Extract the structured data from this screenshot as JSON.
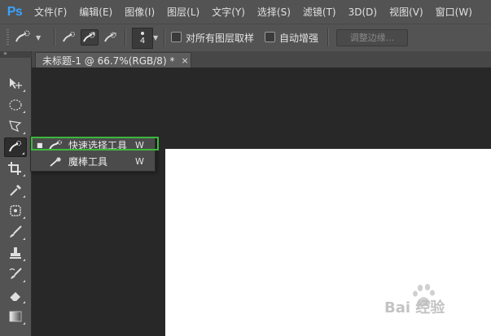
{
  "app": {
    "logo": "Ps"
  },
  "menubar": {
    "items": [
      "文件(F)",
      "编辑(E)",
      "图像(I)",
      "图层(L)",
      "文字(Y)",
      "选择(S)",
      "滤镜(T)",
      "3D(D)",
      "视图(V)",
      "窗口(W)"
    ]
  },
  "options": {
    "tool_icon": "quick-selection-icon",
    "modes": [
      "new-selection-icon",
      "add-to-selection-icon",
      "subtract-from-selection-icon"
    ],
    "brush_size": "4",
    "sample_all_layers_label": "对所有图层取样",
    "sample_all_layers_checked": false,
    "auto_enhance_label": "自动增强",
    "auto_enhance_checked": false,
    "refine_edge_label": "调整边缘..."
  },
  "toolbar": {
    "collapse_glyph": "»",
    "tools": [
      "move-tool-icon",
      "marquee-tool-icon",
      "lasso-tool-icon",
      "quick-selection-tool-icon",
      "crop-tool-icon",
      "eyedropper-tool-icon",
      "spot-healing-tool-icon",
      "brush-tool-icon",
      "clone-stamp-tool-icon",
      "history-brush-tool-icon",
      "eraser-tool-icon",
      "gradient-tool-icon"
    ],
    "active_tool": "quick-selection-tool-icon"
  },
  "document": {
    "tab_title": "未标题-1 @ 66.7%(RGB/8) *",
    "close_glyph": "×"
  },
  "flyout": {
    "items": [
      {
        "label": "快速选择工具",
        "shortcut": "W",
        "selected_marker": "■",
        "icon": "quick-selection-icon"
      },
      {
        "label": "魔棒工具",
        "shortcut": "W",
        "selected_marker": "",
        "icon": "magic-wand-icon"
      }
    ],
    "highlight_color": "#3cb83c"
  },
  "colors": {
    "menubar_bg": "#535353",
    "doc_bg": "#282828",
    "canvas": "#ffffff",
    "logo": "#3aa3ff"
  },
  "watermark": {
    "text": "Bai 经验",
    "icon": "baidu-paw-icon"
  }
}
